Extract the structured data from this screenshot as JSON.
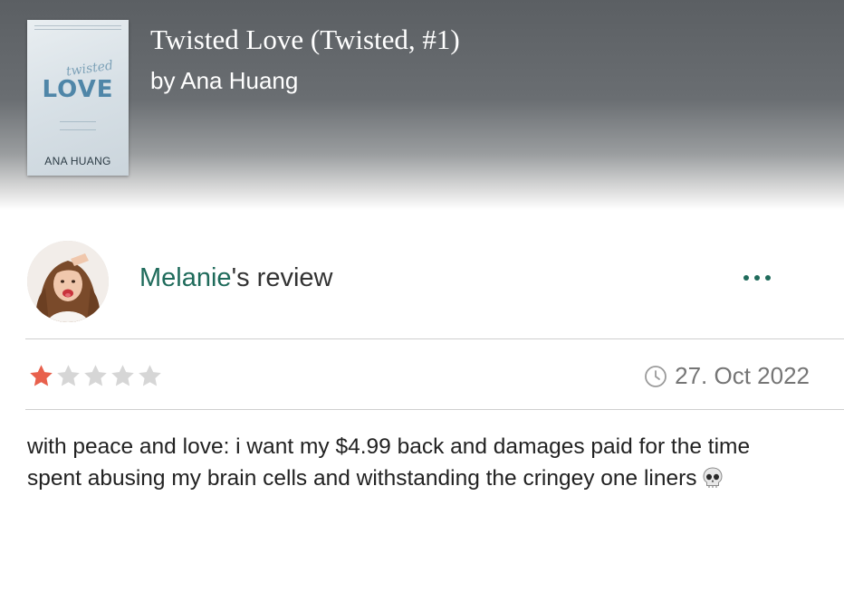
{
  "book": {
    "title": "Twisted Love (Twisted, #1)",
    "author_line": "by Ana Huang",
    "cover": {
      "script_text": "twisted",
      "title_text": "LOVE",
      "author_text": "ANA HUANG"
    }
  },
  "review": {
    "username": "Melanie",
    "heading_suffix": "'s review",
    "rating": 1,
    "rating_max": 5,
    "date": "27. Oct 2022",
    "text": "with peace and love: i want my $4.99 back and damages paid for the time spent abusing my brain cells and withstanding the cringey one liners",
    "emoji_icon": "skull-icon"
  },
  "colors": {
    "accent": "#1f6b5b",
    "star_filled": "#e8604c",
    "star_empty": "#d6d6d6",
    "muted": "#757575"
  }
}
